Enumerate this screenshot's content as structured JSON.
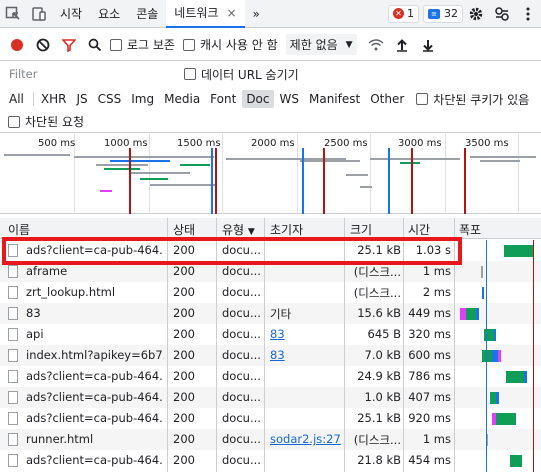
{
  "tabs": {
    "items": [
      "시작",
      "요소",
      "콘솔",
      "네트워크"
    ],
    "more": "»",
    "close": "×",
    "errors": "1",
    "messages": "32"
  },
  "toolbar": {
    "preserve_log": "로그 보존",
    "disable_cache": "캐시 사용 안 함",
    "throttling": "제한 없음"
  },
  "filter": {
    "placeholder": "Filter",
    "hide_data_urls": "데이터 URL 숨기기"
  },
  "types": [
    "All",
    "XHR",
    "JS",
    "CSS",
    "Img",
    "Media",
    "Font",
    "Doc",
    "WS",
    "Manifest",
    "Other"
  ],
  "blocked_cookies": "차단된 쿠키가 있음",
  "blocked_requests": "차단된 요청",
  "overview_ticks": [
    "500 ms",
    "1000 ms",
    "1500 ms",
    "2000 ms",
    "2500 ms",
    "3000 ms",
    "3500 ms"
  ],
  "columns": {
    "name": "이름",
    "status": "상태",
    "type": "유형",
    "sort_arrow": "▼",
    "initiator": "초기자",
    "size": "크기",
    "time": "시간",
    "waterfall": "폭포"
  },
  "rows": [
    {
      "name": "ads?client=ca-pub-464...",
      "status": "200",
      "type": "docu...",
      "initiator": "",
      "size": "25.1 kB",
      "time": "1.03 s"
    },
    {
      "name": "aframe",
      "status": "200",
      "type": "docu...",
      "initiator": "",
      "size": "(디스크...",
      "time": "1 ms"
    },
    {
      "name": "zrt_lookup.html",
      "status": "200",
      "type": "docu...",
      "initiator": "",
      "size": "(디스크...",
      "time": "2 ms"
    },
    {
      "name": "83",
      "status": "200",
      "type": "docu...",
      "initiator": "기타",
      "size": "15.6 kB",
      "time": "449 ms"
    },
    {
      "name": "api",
      "status": "200",
      "type": "docu...",
      "initiator": "83",
      "size": "645 B",
      "time": "320 ms"
    },
    {
      "name": "index.html?apikey=6b7...",
      "status": "200",
      "type": "docu...",
      "initiator": "83",
      "size": "7.0 kB",
      "time": "600 ms"
    },
    {
      "name": "ads?client=ca-pub-464...",
      "status": "200",
      "type": "docu...",
      "initiator": "",
      "size": "24.9 kB",
      "time": "786 ms"
    },
    {
      "name": "ads?client=ca-pub-464...",
      "status": "200",
      "type": "docu...",
      "initiator": "",
      "size": "1.0 kB",
      "time": "407 ms"
    },
    {
      "name": "ads?client=ca-pub-464...",
      "status": "200",
      "type": "docu...",
      "initiator": "",
      "size": "25.1 kB",
      "time": "920 ms"
    },
    {
      "name": "runner.html",
      "status": "200",
      "type": "docu...",
      "initiator": "sodar2.js:27",
      "size": "(디스크...",
      "time": "1 ms"
    },
    {
      "name": "ads?client=ca-pub-464...",
      "status": "200",
      "type": "docu...",
      "initiator": "",
      "size": "21.8 kB",
      "time": "454 ms"
    }
  ]
}
